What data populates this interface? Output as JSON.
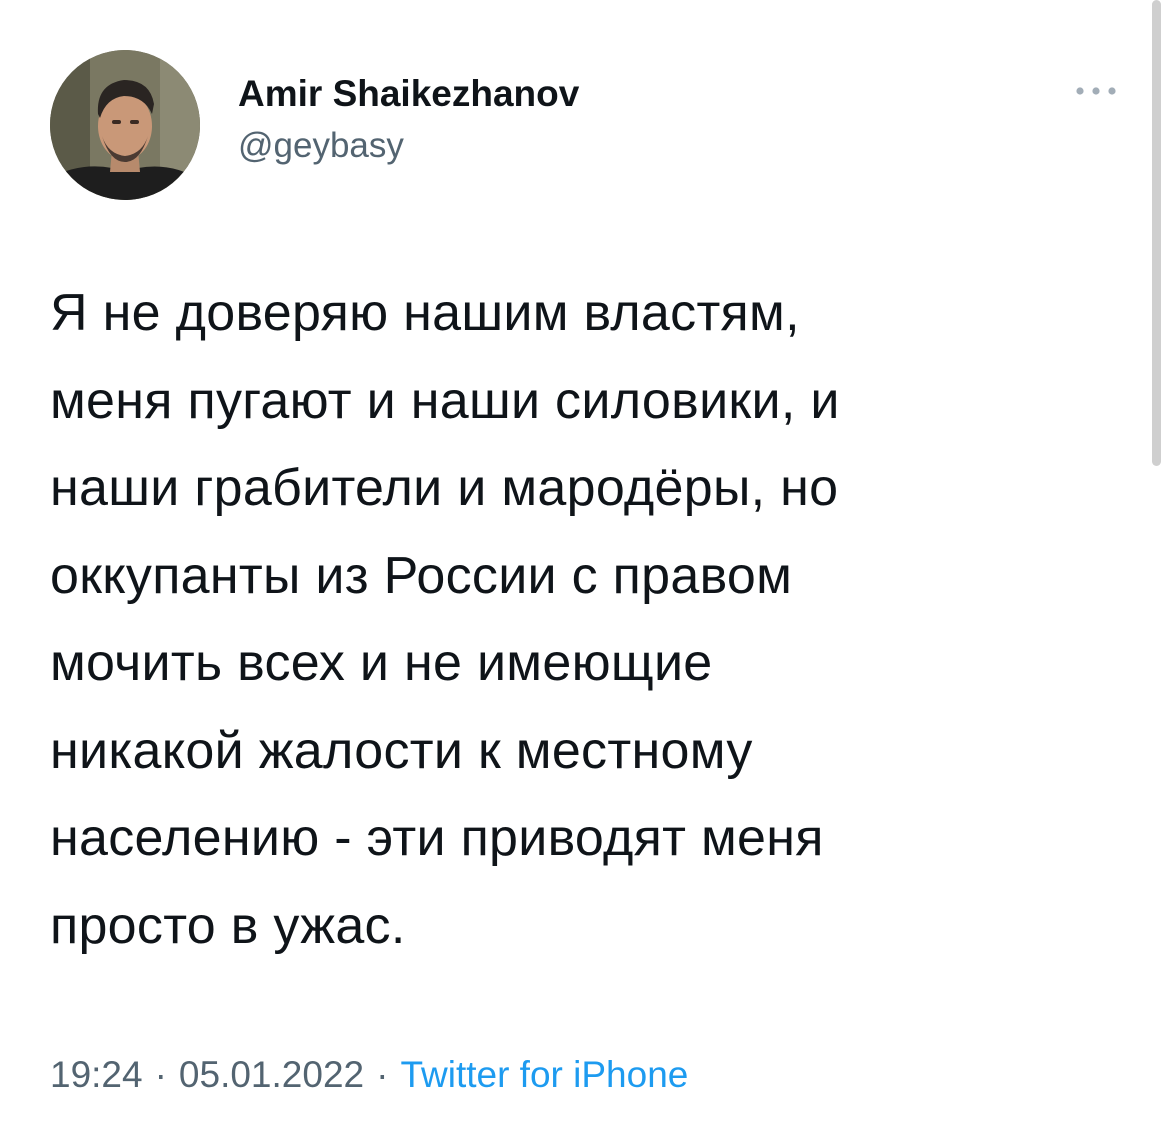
{
  "author": {
    "display_name": "Amir Shaikezhanov",
    "handle": "@geybasy"
  },
  "more_icon": "ellipsis-horizontal-icon",
  "tweet": {
    "text": "Я не доверяю нашим властям,\nменя пугают и наши силовики, и\nнаши грабители и мародёры, но\nоккупанты из России с правом\nмочить всех и не имеющие\nникакой жалости к местному\nнаселению - эти приводят меня\nпросто в ужас."
  },
  "meta": {
    "time": "19:24",
    "separator": "·",
    "date": "05.01.2022",
    "source": "Twitter for iPhone"
  },
  "colors": {
    "text": "#0f1419",
    "secondary": "#536471",
    "link": "#1d9bf0"
  }
}
